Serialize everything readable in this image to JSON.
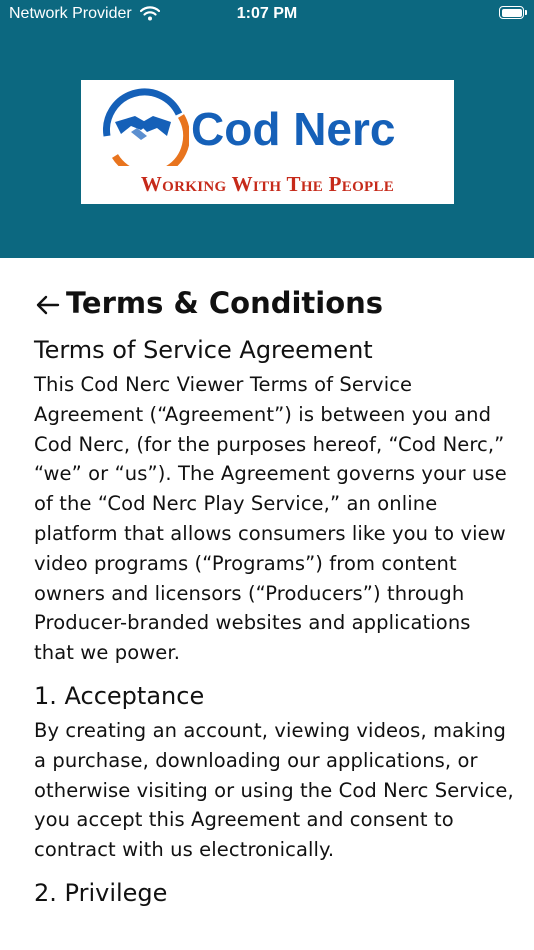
{
  "status_bar": {
    "carrier": "Network Provider",
    "time": "1:07 PM",
    "wifi_icon": "wifi-icon",
    "battery_icon": "battery-icon"
  },
  "header": {
    "background_color": "#0c6880",
    "logo": {
      "name": "Cod Nerc",
      "tagline": "Working With The People",
      "emblem_icon": "handshake-icon"
    }
  },
  "page": {
    "back_icon": "arrow-left-icon",
    "title": "Terms & Conditions",
    "heading": "Terms of Service Agreement",
    "intro": "This Cod Nerc Viewer Terms of Service Agreement (“Agreement”) is between you and Cod Nerc, (for the purposes hereof, “Cod Nerc,” “we” or “us”). The Agreement governs your use of the “Cod Nerc Play Service,” an online platform that allows consumers like you to view video programs (“Programs”) from content owners and licensors (“Producers”) through Producer-branded websites and applications that we power.",
    "sections": [
      {
        "heading": "1. Acceptance",
        "body": "By creating an account, viewing videos, making a purchase, downloading our applications, or otherwise visiting or using the Cod Nerc Service, you accept this Agreement and consent to contract with us electronically."
      },
      {
        "heading": "2. Privilege",
        "body": ""
      }
    ]
  }
}
